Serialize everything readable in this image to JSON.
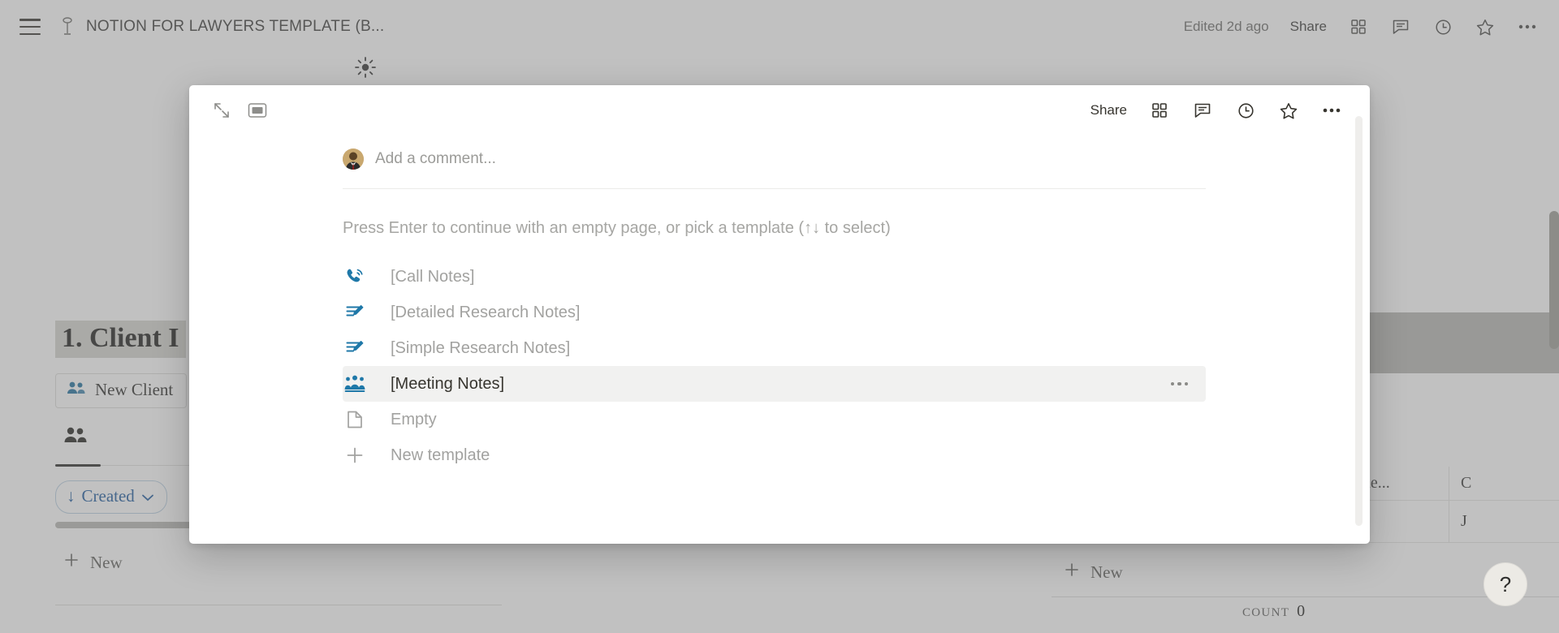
{
  "topbar": {
    "menu_icon": "hamburger-menu-icon",
    "page_icon": "document-pin-icon",
    "title": "NOTION FOR LAWYERS TEMPLATE (B...",
    "edited": "Edited 2d ago",
    "share_label": "Share",
    "icons": [
      "grid-blocks-icon",
      "comment-icon",
      "history-clock-icon",
      "star-icon",
      "more-horizontal-icon"
    ]
  },
  "background": {
    "sun_icon": "sun-icon",
    "heading": "1. Client I",
    "new_client_button": "New Client",
    "view_tab_icon": "people-icon",
    "sort_chip": {
      "arrow": "↓",
      "label": "Created",
      "chevron": "⌄",
      "color": "#1c5a9e"
    },
    "new_row_left": "New",
    "new_row_right": "New",
    "table": {
      "headers": [
        "ient Name...",
        "C"
      ],
      "rows": [
        [
          "",
          "J"
        ]
      ]
    },
    "count_label": "COUNT",
    "count_value": "0",
    "help_label": "?"
  },
  "modal": {
    "expand_icon": "expand-diagonal-icon",
    "peek_icon": "side-peek-icon",
    "share_label": "Share",
    "tool_icons": [
      "grid-blocks-icon",
      "comment-icon",
      "history-clock-icon",
      "star-icon",
      "more-horizontal-icon"
    ],
    "comment": {
      "avatar": "user-avatar",
      "placeholder": "Add a comment..."
    },
    "hint": "Press Enter to continue with an empty page, or pick a template (↑↓ to select)",
    "templates": [
      {
        "icon": "phone-call-icon",
        "label": "[Call Notes]",
        "active": false
      },
      {
        "icon": "note-edit-icon",
        "label": "[Detailed Research Notes]",
        "active": false
      },
      {
        "icon": "note-edit-icon",
        "label": "[Simple Research Notes]",
        "active": false
      },
      {
        "icon": "people-group-icon",
        "label": "[Meeting Notes]",
        "active": true
      },
      {
        "icon": "empty-page-icon",
        "label": "Empty",
        "active": false
      },
      {
        "icon": "plus-icon",
        "label": "New template",
        "active": false
      }
    ],
    "row_more_icon": "more-horizontal-icon"
  }
}
